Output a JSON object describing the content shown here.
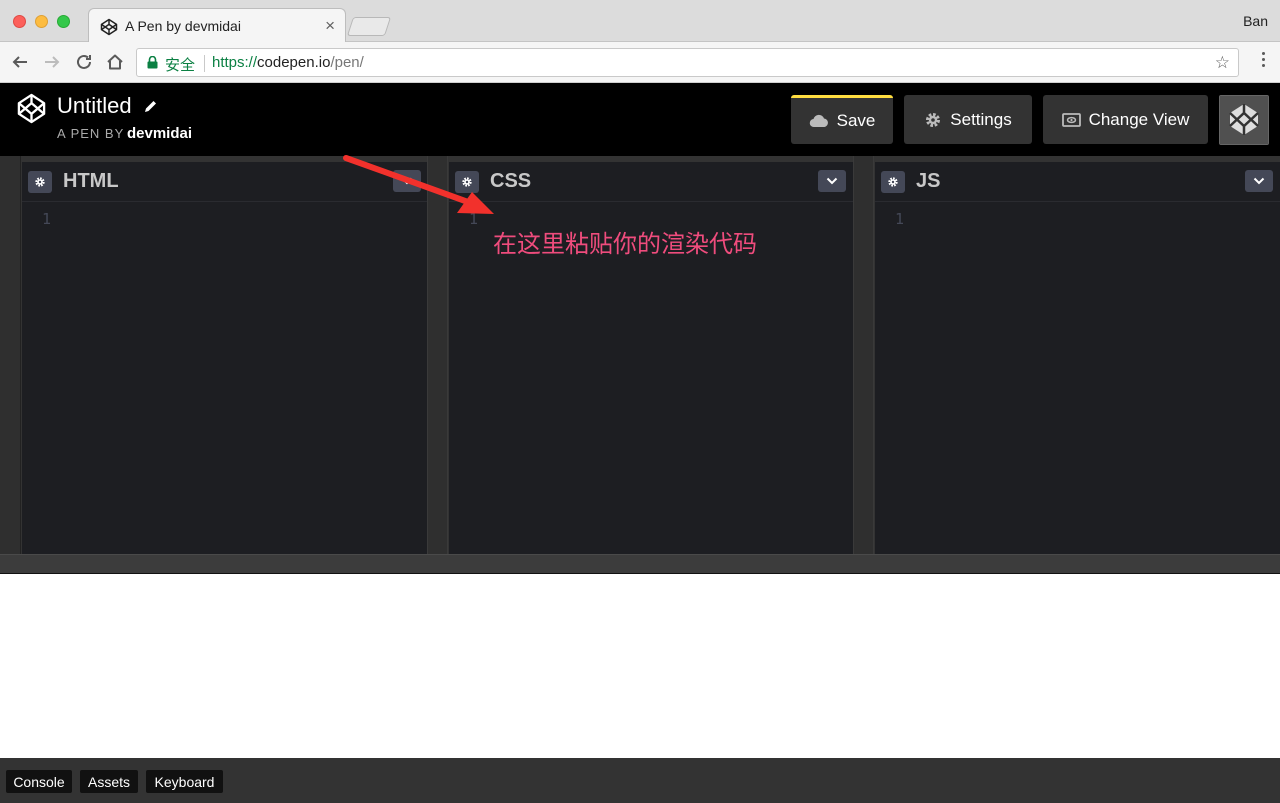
{
  "browser": {
    "tab_title": "A Pen by devmidai",
    "tab_close": "×",
    "profile_name": "Ban",
    "secure_label": "安全",
    "url_scheme": "https://",
    "url_host": "codepen.io",
    "url_path": "/pen/",
    "bookmark_icon": "star-icon"
  },
  "header": {
    "pen_title": "Untitled",
    "pen_by_label": "A PEN BY",
    "username": "devmidai",
    "save_label": "Save",
    "settings_label": "Settings",
    "change_view_label": "Change View"
  },
  "editors": [
    {
      "title": "HTML",
      "line": "1"
    },
    {
      "title": "CSS",
      "line": "1"
    },
    {
      "title": "JS",
      "line": "1"
    }
  ],
  "annotation": {
    "text": "在这里粘贴你的渲染代码",
    "color": "#ef4c7d"
  },
  "footer": {
    "console_label": "Console",
    "assets_label": "Assets",
    "keyboard_label": "Keyboard"
  },
  "colors": {
    "save_accent": "#ffdd40",
    "editor_bg": "#1d1e22",
    "secure_green": "#0b8043"
  }
}
